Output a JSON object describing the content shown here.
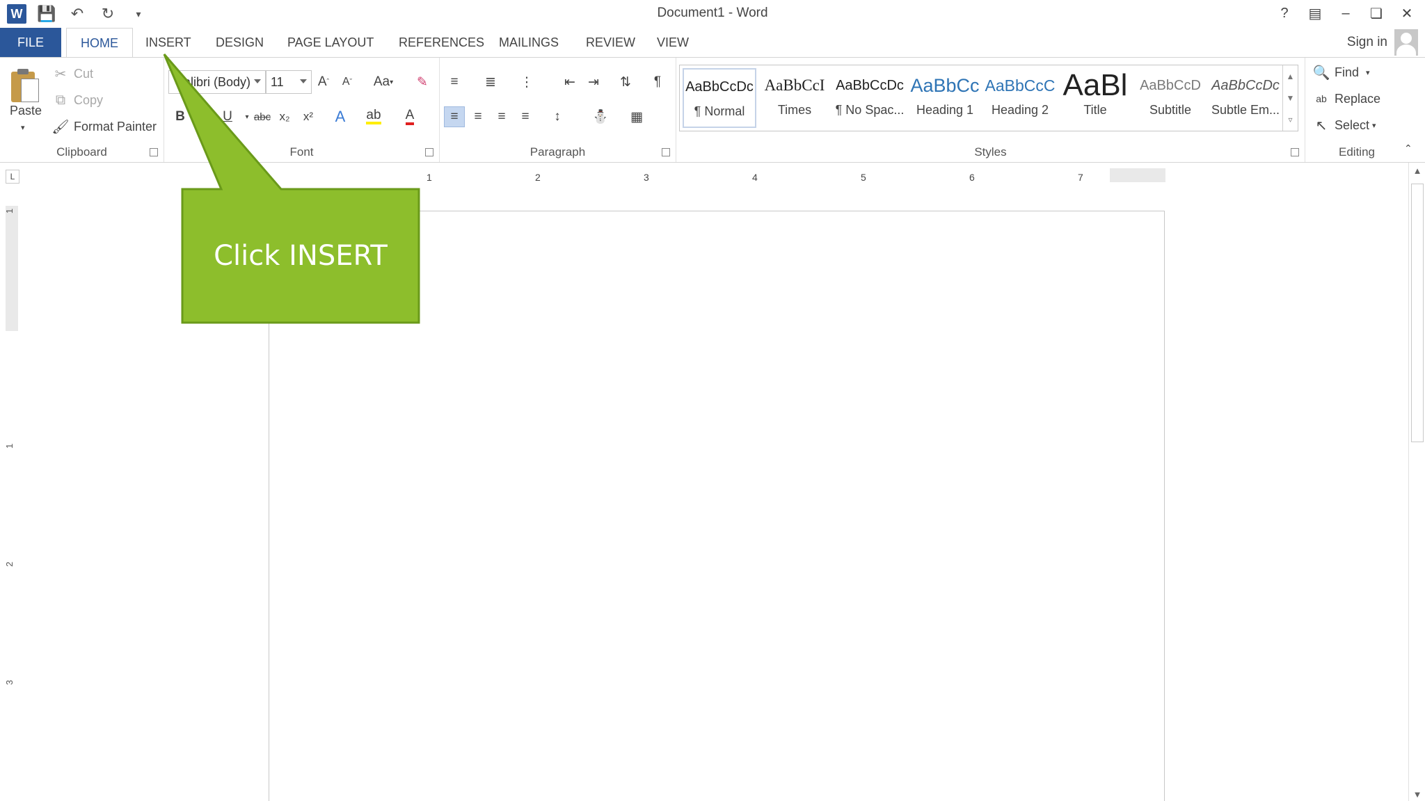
{
  "titlebar": {
    "title": "Document1 - Word",
    "app_icon": "W",
    "controls": [
      "help-icon",
      "ribbon-display-icon",
      "minimize-icon",
      "restore-icon",
      "close-icon"
    ]
  },
  "tabs": {
    "file": "FILE",
    "home": "HOME",
    "insert": "INSERT",
    "design": "DESIGN",
    "page_layout": "PAGE LAYOUT",
    "references": "REFERENCES",
    "mailings": "MAILINGS",
    "review": "REVIEW",
    "view": "VIEW",
    "sign_in": "Sign in"
  },
  "clipboard": {
    "label": "Clipboard",
    "paste": "Paste",
    "cut": "Cut",
    "copy": "Copy",
    "format_painter": "Format Painter"
  },
  "font": {
    "label": "Font",
    "font_name": "Calibri (Body)",
    "font_size": "11",
    "bold": "B",
    "underline": "U",
    "strikethrough": "abc",
    "subscript": "x₂",
    "superscript": "x²",
    "grow": "A",
    "shrink": "A",
    "change_case": "Aa"
  },
  "paragraph": {
    "label": "Paragraph"
  },
  "styles": {
    "label": "Styles",
    "items": [
      {
        "sample": "AaBbCcDc",
        "name": "¶ Normal"
      },
      {
        "sample": "AaBbCcI",
        "name": "Times"
      },
      {
        "sample": "AaBbCcDc",
        "name": "¶ No Spac..."
      },
      {
        "sample": "AaBbCc",
        "name": "Heading 1"
      },
      {
        "sample": "AaBbCcC",
        "name": "Heading 2"
      },
      {
        "sample": "AaBl",
        "name": "Title"
      },
      {
        "sample": "AaBbCcD",
        "name": "Subtitle"
      },
      {
        "sample": "AaBbCcDc",
        "name": "Subtle Em..."
      }
    ]
  },
  "editing": {
    "label": "Editing",
    "find": "Find",
    "replace": "Replace",
    "select": "Select"
  },
  "ruler": {
    "marks": [
      "1",
      "2",
      "3",
      "4",
      "5",
      "6",
      "7"
    ],
    "vmarks": [
      "1",
      "1",
      "2",
      "3"
    ],
    "corner": "L"
  },
  "callout": {
    "text": "Click INSERT",
    "color": "#8dbe2c",
    "border_color": "#6a9a1a"
  },
  "colors": {
    "accent": "#2b579a"
  }
}
